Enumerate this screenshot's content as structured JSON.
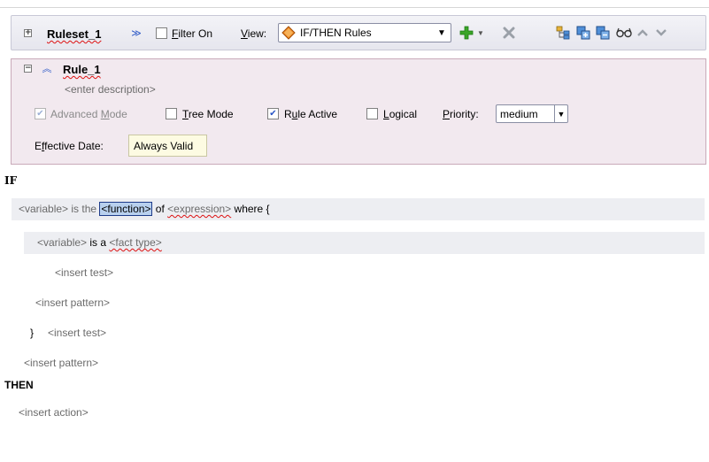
{
  "toolbar": {
    "ruleset_name": "Ruleset_1",
    "filter_label": "Filter On",
    "view_label": "View:",
    "view_value": "IF/THEN Rules"
  },
  "rule": {
    "name": "Rule_1",
    "description_placeholder": "<enter description>",
    "advanced_mode_label": "Advanced Mode",
    "advanced_mode_checked": true,
    "tree_mode_label": "Tree Mode",
    "tree_mode_checked": false,
    "rule_active_label": "Rule Active",
    "rule_active_checked": true,
    "logical_label": "Logical",
    "logical_checked": false,
    "priority_label": "Priority:",
    "priority_value": "medium",
    "effective_date_label": "Effective Date:",
    "effective_date_value": "Always Valid"
  },
  "editor": {
    "if_label": "IF",
    "line1": {
      "variable": "<variable>",
      "is_the": " is the ",
      "function": "<function>",
      "of": " of ",
      "expression": "<expression>",
      "where": " where {"
    },
    "line2": {
      "variable": "<variable>",
      "is_a": " is a ",
      "fact_type": "<fact type>"
    },
    "insert_test_inner": "<insert test>",
    "insert_pattern_inner": "<insert pattern>",
    "close_brace": "}",
    "insert_test_outer": "<insert test>",
    "insert_pattern_outer": "<insert pattern>",
    "then_label": "THEN",
    "insert_action": "<insert action>"
  },
  "colors": {
    "rule_panel_bg": "#f2e9ef",
    "selection_bg": "#b8d0ee",
    "add_icon": "#3aa528"
  }
}
